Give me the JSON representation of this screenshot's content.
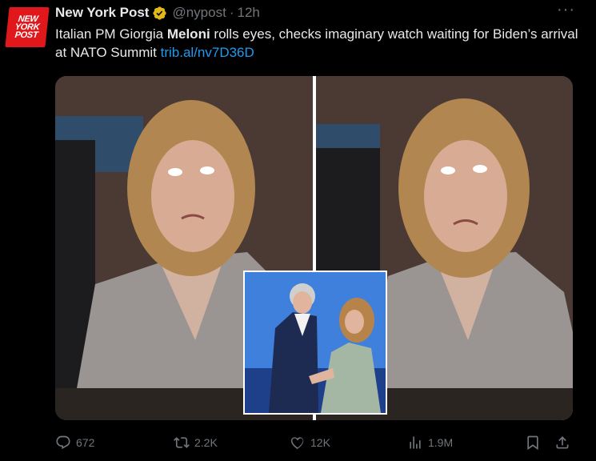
{
  "tweet": {
    "author_name": "New York Post",
    "handle": "@nypost",
    "separator": "·",
    "time": "12h",
    "text_part1": "Italian PM Giorgia ",
    "text_bold": "Meloni",
    "text_part2": " rolls eyes, checks imaginary watch waiting for Biden’s arrival at NATO Summit ",
    "link": "trib.al/nv7D36D",
    "more_label": "···"
  },
  "avatar": {
    "line1": "NEW",
    "line2": "YORK",
    "line3": "POST"
  },
  "metrics": {
    "replies": "672",
    "reposts": "2.2K",
    "likes": "12K",
    "views": "1.9M"
  },
  "colors": {
    "background": "#000000",
    "text": "#e7e9ea",
    "muted": "#71767b",
    "link": "#1d9bf0",
    "brand_red": "#e0171b",
    "verified_gold": "#e2b719"
  },
  "icons": [
    "verified-badge-icon",
    "more-icon",
    "reply-icon",
    "repost-icon",
    "like-icon",
    "views-icon",
    "bookmark-icon",
    "share-icon"
  ]
}
